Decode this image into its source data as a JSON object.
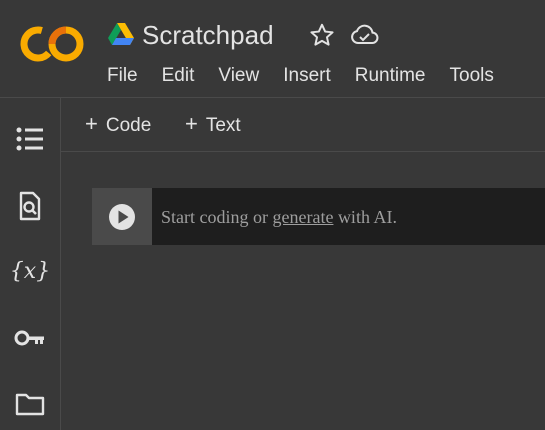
{
  "header": {
    "title": "Scratchpad",
    "logo_text": "CO",
    "menu": [
      "File",
      "Edit",
      "View",
      "Insert",
      "Runtime",
      "Tools"
    ]
  },
  "toolbar": {
    "code_label": "Code",
    "text_label": "Text",
    "plus": "+"
  },
  "sidebar": {
    "items": [
      {
        "icon": "table-of-contents-icon"
      },
      {
        "icon": "find-replace-icon"
      },
      {
        "icon": "variables-icon",
        "glyph": "{x}"
      },
      {
        "icon": "secrets-key-icon"
      },
      {
        "icon": "files-folder-icon"
      }
    ]
  },
  "cell": {
    "prefix": "Start coding or ",
    "link": "generate",
    "suffix": " with AI."
  },
  "colors": {
    "background": "#383838",
    "cell_background": "#1e1e1e",
    "logo_orange": "#f9ab00",
    "logo_dark_orange": "#e8710a"
  }
}
